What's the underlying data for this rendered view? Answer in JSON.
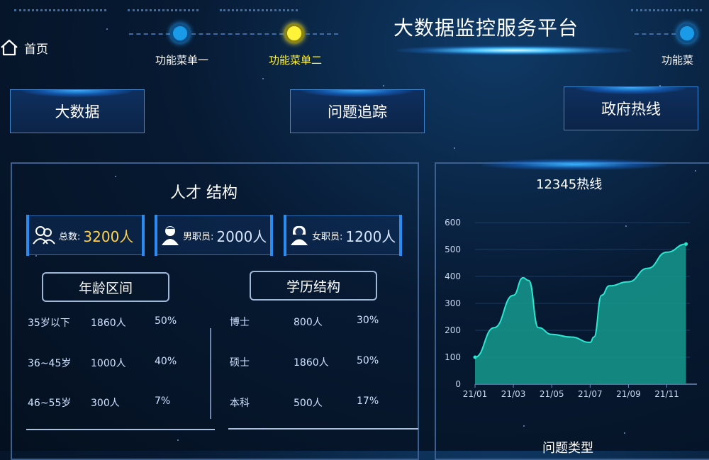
{
  "header": {
    "home_label": "首页",
    "title": "大数据监控服务平台",
    "steps": [
      {
        "label": "功能菜单一",
        "state": "inactive",
        "color": "#1a9be8"
      },
      {
        "label": "功能菜单二",
        "state": "active",
        "color": "#fff33a"
      },
      {
        "label": "功能菜单三",
        "visible_text": "功能菜",
        "state": "inactive",
        "color": "#1a9be8"
      }
    ]
  },
  "nav": {
    "big_data": "大数据",
    "issue_tracking": "问题追踪",
    "gov_hotline": "政府热线"
  },
  "talent": {
    "title": "人才 结构",
    "stats": [
      {
        "label": "总数:",
        "value": "3200人",
        "color": "#ffd24a",
        "icon": "group-icon"
      },
      {
        "label": "男职员:",
        "value": "2000人",
        "color": "#d7e6ff",
        "icon": "male-user-icon"
      },
      {
        "label": "女职员:",
        "value": "1200人",
        "color": "#d7e6ff",
        "icon": "female-user-icon"
      }
    ],
    "age": {
      "title": "年龄区间",
      "rows": [
        {
          "range": "35岁以下",
          "count": "1860人",
          "pct": "50%"
        },
        {
          "range": "36~45岁",
          "count": "1000人",
          "pct": "40%"
        },
        {
          "range": "46~55岁",
          "count": "300人",
          "pct": "7%"
        }
      ]
    },
    "education": {
      "title": "学历结构",
      "rows": [
        {
          "level": "博士",
          "count": "800人",
          "pct": "30%"
        },
        {
          "level": "硕士",
          "count": "1860人",
          "pct": "50%"
        },
        {
          "level": "本科",
          "count": "500人",
          "pct": "17%"
        }
      ]
    }
  },
  "hotline": {
    "bottom_label": "问题类型"
  },
  "chart_data": {
    "type": "area",
    "title": "12345热线",
    "x_ticks": [
      "21/01",
      "21/03",
      "21/05",
      "21/07",
      "21/09",
      "21/11"
    ],
    "y_ticks": [
      0,
      100,
      200,
      300,
      400,
      500,
      600
    ],
    "ylim": [
      0,
      600
    ],
    "xlim": [
      1,
      12.2
    ],
    "points": [
      {
        "x": 1.0,
        "y": 100
      },
      {
        "x": 2.0,
        "y": 210
      },
      {
        "x": 3.0,
        "y": 330
      },
      {
        "x": 3.5,
        "y": 395
      },
      {
        "x": 3.8,
        "y": 385
      },
      {
        "x": 4.3,
        "y": 210
      },
      {
        "x": 5.0,
        "y": 185
      },
      {
        "x": 6.0,
        "y": 175
      },
      {
        "x": 7.0,
        "y": 155
      },
      {
        "x": 7.2,
        "y": 175
      },
      {
        "x": 7.6,
        "y": 330
      },
      {
        "x": 8.0,
        "y": 365
      },
      {
        "x": 9.0,
        "y": 380
      },
      {
        "x": 10.0,
        "y": 430
      },
      {
        "x": 11.0,
        "y": 490
      },
      {
        "x": 12.0,
        "y": 520
      }
    ],
    "line_color": "#2ee6d0",
    "fill_color": "#15928a",
    "grid": true
  }
}
